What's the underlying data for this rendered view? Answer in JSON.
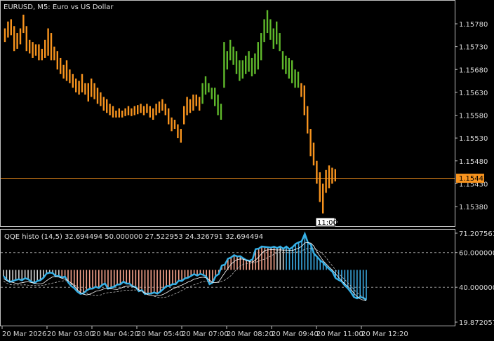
{
  "main_chart": {
    "title": "EURUSD, M5:  Euro vs US Dollar",
    "price_ticks": [
      "1.15780",
      "1.15730",
      "1.15680",
      "1.15630",
      "1.15580",
      "1.15530",
      "1.15480",
      "1.15430",
      "1.15380"
    ],
    "current_price": "1.15442",
    "current_price_value": 1.15442,
    "time_marker": "11:00",
    "colors": {
      "bar_orange": "#f7931e",
      "bar_green": "#5fb82b",
      "current_line": "#f7931e",
      "frame": "#c0c0c0"
    }
  },
  "chart_data": {
    "type": "bar",
    "title": "EURUSD, M5:  Euro vs US Dollar",
    "ylim": [
      1.15355,
      1.1581
    ],
    "bars": [
      {
        "lo": 1.1574,
        "hi": 1.1577,
        "c": "o"
      },
      {
        "lo": 1.1575,
        "hi": 1.15785,
        "c": "o"
      },
      {
        "lo": 1.15755,
        "hi": 1.1579,
        "c": "o"
      },
      {
        "lo": 1.1572,
        "hi": 1.15775,
        "c": "o"
      },
      {
        "lo": 1.15725,
        "hi": 1.1576,
        "c": "o"
      },
      {
        "lo": 1.15735,
        "hi": 1.1577,
        "c": "o"
      },
      {
        "lo": 1.1576,
        "hi": 1.158,
        "c": "o"
      },
      {
        "lo": 1.1572,
        "hi": 1.15775,
        "c": "o"
      },
      {
        "lo": 1.15715,
        "hi": 1.15745,
        "c": "o"
      },
      {
        "lo": 1.15705,
        "hi": 1.1574,
        "c": "o"
      },
      {
        "lo": 1.1571,
        "hi": 1.15735,
        "c": "o"
      },
      {
        "lo": 1.157,
        "hi": 1.15735,
        "c": "o"
      },
      {
        "lo": 1.157,
        "hi": 1.15725,
        "c": "o"
      },
      {
        "lo": 1.15705,
        "hi": 1.15745,
        "c": "o"
      },
      {
        "lo": 1.1571,
        "hi": 1.1577,
        "c": "o"
      },
      {
        "lo": 1.157,
        "hi": 1.1576,
        "c": "o"
      },
      {
        "lo": 1.157,
        "hi": 1.1573,
        "c": "o"
      },
      {
        "lo": 1.1568,
        "hi": 1.1572,
        "c": "o"
      },
      {
        "lo": 1.1567,
        "hi": 1.15705,
        "c": "o"
      },
      {
        "lo": 1.1566,
        "hi": 1.1569,
        "c": "o"
      },
      {
        "lo": 1.15655,
        "hi": 1.157,
        "c": "o"
      },
      {
        "lo": 1.1565,
        "hi": 1.1568,
        "c": "o"
      },
      {
        "lo": 1.1564,
        "hi": 1.1567,
        "c": "o"
      },
      {
        "lo": 1.1563,
        "hi": 1.1566,
        "c": "o"
      },
      {
        "lo": 1.15625,
        "hi": 1.15655,
        "c": "o"
      },
      {
        "lo": 1.1563,
        "hi": 1.1567,
        "c": "o"
      },
      {
        "lo": 1.15625,
        "hi": 1.1565,
        "c": "o"
      },
      {
        "lo": 1.1561,
        "hi": 1.1565,
        "c": "o"
      },
      {
        "lo": 1.1562,
        "hi": 1.1566,
        "c": "o"
      },
      {
        "lo": 1.15615,
        "hi": 1.1565,
        "c": "o"
      },
      {
        "lo": 1.15605,
        "hi": 1.1564,
        "c": "o"
      },
      {
        "lo": 1.156,
        "hi": 1.1563,
        "c": "o"
      },
      {
        "lo": 1.1559,
        "hi": 1.1562,
        "c": "o"
      },
      {
        "lo": 1.15585,
        "hi": 1.15615,
        "c": "o"
      },
      {
        "lo": 1.1558,
        "hi": 1.15605,
        "c": "o"
      },
      {
        "lo": 1.15575,
        "hi": 1.156,
        "c": "o"
      },
      {
        "lo": 1.15575,
        "hi": 1.1559,
        "c": "o"
      },
      {
        "lo": 1.15575,
        "hi": 1.15595,
        "c": "o"
      },
      {
        "lo": 1.15575,
        "hi": 1.1559,
        "c": "o"
      },
      {
        "lo": 1.15578,
        "hi": 1.15595,
        "c": "o"
      },
      {
        "lo": 1.1558,
        "hi": 1.156,
        "c": "o"
      },
      {
        "lo": 1.15578,
        "hi": 1.15595,
        "c": "o"
      },
      {
        "lo": 1.1558,
        "hi": 1.156,
        "c": "o"
      },
      {
        "lo": 1.15582,
        "hi": 1.15602,
        "c": "o"
      },
      {
        "lo": 1.15585,
        "hi": 1.15605,
        "c": "o"
      },
      {
        "lo": 1.1558,
        "hi": 1.156,
        "c": "o"
      },
      {
        "lo": 1.15585,
        "hi": 1.15605,
        "c": "o"
      },
      {
        "lo": 1.15575,
        "hi": 1.156,
        "c": "o"
      },
      {
        "lo": 1.1557,
        "hi": 1.15595,
        "c": "o"
      },
      {
        "lo": 1.1558,
        "hi": 1.15605,
        "c": "o"
      },
      {
        "lo": 1.15585,
        "hi": 1.1561,
        "c": "o"
      },
      {
        "lo": 1.1559,
        "hi": 1.15615,
        "c": "o"
      },
      {
        "lo": 1.1558,
        "hi": 1.15605,
        "c": "o"
      },
      {
        "lo": 1.1556,
        "hi": 1.15595,
        "c": "o"
      },
      {
        "lo": 1.15545,
        "hi": 1.15575,
        "c": "o"
      },
      {
        "lo": 1.1555,
        "hi": 1.1557,
        "c": "o"
      },
      {
        "lo": 1.1553,
        "hi": 1.1556,
        "c": "o"
      },
      {
        "lo": 1.1552,
        "hi": 1.1555,
        "c": "o"
      },
      {
        "lo": 1.1556,
        "hi": 1.156,
        "c": "o"
      },
      {
        "lo": 1.1558,
        "hi": 1.1562,
        "c": "o"
      },
      {
        "lo": 1.15585,
        "hi": 1.15615,
        "c": "o"
      },
      {
        "lo": 1.1559,
        "hi": 1.15625,
        "c": "o"
      },
      {
        "lo": 1.156,
        "hi": 1.15625,
        "c": "o"
      },
      {
        "lo": 1.1559,
        "hi": 1.1562,
        "c": "o"
      },
      {
        "lo": 1.15605,
        "hi": 1.1565,
        "c": "g"
      },
      {
        "lo": 1.15625,
        "hi": 1.15665,
        "c": "g"
      },
      {
        "lo": 1.1563,
        "hi": 1.1565,
        "c": "g"
      },
      {
        "lo": 1.15615,
        "hi": 1.1564,
        "c": "g"
      },
      {
        "lo": 1.156,
        "hi": 1.1564,
        "c": "g"
      },
      {
        "lo": 1.1558,
        "hi": 1.15625,
        "c": "g"
      },
      {
        "lo": 1.1557,
        "hi": 1.15605,
        "c": "g"
      },
      {
        "lo": 1.1564,
        "hi": 1.1574,
        "c": "g"
      },
      {
        "lo": 1.1568,
        "hi": 1.1572,
        "c": "g"
      },
      {
        "lo": 1.157,
        "hi": 1.15745,
        "c": "g"
      },
      {
        "lo": 1.1569,
        "hi": 1.1573,
        "c": "g"
      },
      {
        "lo": 1.1567,
        "hi": 1.1572,
        "c": "g"
      },
      {
        "lo": 1.15655,
        "hi": 1.157,
        "c": "g"
      },
      {
        "lo": 1.1566,
        "hi": 1.157,
        "c": "g"
      },
      {
        "lo": 1.1567,
        "hi": 1.1571,
        "c": "g"
      },
      {
        "lo": 1.15675,
        "hi": 1.1572,
        "c": "g"
      },
      {
        "lo": 1.15665,
        "hi": 1.15705,
        "c": "g"
      },
      {
        "lo": 1.1567,
        "hi": 1.15715,
        "c": "g"
      },
      {
        "lo": 1.1568,
        "hi": 1.1574,
        "c": "g"
      },
      {
        "lo": 1.157,
        "hi": 1.1576,
        "c": "g"
      },
      {
        "lo": 1.1574,
        "hi": 1.1579,
        "c": "g"
      },
      {
        "lo": 1.1576,
        "hi": 1.1581,
        "c": "g"
      },
      {
        "lo": 1.15745,
        "hi": 1.1579,
        "c": "g"
      },
      {
        "lo": 1.15725,
        "hi": 1.1577,
        "c": "g"
      },
      {
        "lo": 1.15735,
        "hi": 1.15785,
        "c": "g"
      },
      {
        "lo": 1.1572,
        "hi": 1.1576,
        "c": "g"
      },
      {
        "lo": 1.1568,
        "hi": 1.1572,
        "c": "g"
      },
      {
        "lo": 1.1567,
        "hi": 1.1571,
        "c": "g"
      },
      {
        "lo": 1.1566,
        "hi": 1.15705,
        "c": "g"
      },
      {
        "lo": 1.1565,
        "hi": 1.157,
        "c": "g"
      },
      {
        "lo": 1.1564,
        "hi": 1.1568,
        "c": "g"
      },
      {
        "lo": 1.1564,
        "hi": 1.15675,
        "c": "g"
      },
      {
        "lo": 1.1562,
        "hi": 1.1565,
        "c": "o"
      },
      {
        "lo": 1.1558,
        "hi": 1.15645,
        "c": "o"
      },
      {
        "lo": 1.1554,
        "hi": 1.156,
        "c": "o"
      },
      {
        "lo": 1.1549,
        "hi": 1.1555,
        "c": "o"
      },
      {
        "lo": 1.1547,
        "hi": 1.1552,
        "c": "o"
      },
      {
        "lo": 1.1543,
        "hi": 1.1548,
        "c": "o"
      },
      {
        "lo": 1.1539,
        "hi": 1.15455,
        "c": "o"
      },
      {
        "lo": 1.15365,
        "hi": 1.1543,
        "c": "o"
      },
      {
        "lo": 1.1541,
        "hi": 1.1546,
        "c": "o"
      },
      {
        "lo": 1.1542,
        "hi": 1.1547,
        "c": "o"
      },
      {
        "lo": 1.1543,
        "hi": 1.15465,
        "c": "o"
      },
      {
        "lo": 1.15435,
        "hi": 1.15462,
        "c": "o"
      }
    ]
  },
  "indicator": {
    "label": "QQE histo (14,5) 32.694494 50.000000 27.522953 24.326791 32.694494",
    "ticks": [
      "71.207561",
      "60.000000",
      "40.000000",
      "19.872057"
    ],
    "tick_values": [
      71.207561,
      60.0,
      40.0,
      19.872057
    ],
    "levels": [
      60,
      40
    ],
    "zero_level": 50,
    "colors": {
      "hist_down": "#f5a38c",
      "hist_up": "#3aa8e0",
      "hist_neutral": "#d0d0d0",
      "rsi_line": "#36b0e6",
      "level_line": "#9a9a9a"
    },
    "rsi": [
      46.5,
      44.3,
      43.1,
      43.5,
      44.2,
      44.6,
      44.0,
      45.2,
      44.6,
      43.3,
      42.4,
      43.6,
      44.1,
      45.5,
      47.9,
      48.4,
      48.2,
      46.3,
      46.6,
      45.6,
      46.2,
      42.9,
      40.7,
      39.5,
      37.5,
      36.2,
      36.5,
      38.1,
      39.1,
      39.2,
      40.3,
      39.5,
      41.2,
      42.2,
      39.2,
      39.8,
      40.3,
      41.5,
      41.7,
      43.2,
      42.1,
      42.1,
      40.5,
      40.1,
      37.7,
      38.3,
      36.1,
      36.4,
      36.3,
      37.0,
      36.3,
      37.4,
      39.0,
      40.7,
      40.7,
      41.8,
      41.8,
      43.8,
      43.6,
      45.1,
      45.5,
      46.5,
      47.6,
      46.7,
      47.7,
      47.1,
      45.9,
      41.8,
      42.6,
      46.4,
      47.6,
      52.5,
      53.1,
      56.4,
      57.2,
      58.5,
      57.8,
      57.9,
      56.7,
      55.6,
      55.3,
      56.1,
      62.0,
      62.3,
      63.5,
      63.3,
      63.1,
      62.9,
      63.4,
      62.6,
      63.5,
      62.2,
      63.5,
      62.0,
      63.1,
      65.0,
      65.9,
      66.6,
      70.8,
      65.8,
      64.5,
      59.4,
      57.6,
      55.5,
      54.1,
      52.1,
      50.4,
      48.9,
      45.3,
      44.2,
      43.3,
      41.0,
      39.4,
      37.1,
      34.3,
      33.6,
      34.4,
      33.9,
      32.7
    ],
    "hist_colors": "gggggggggggggggggggrrrrrrrrrrrrrrrrrrrrrrrrrrrrrrrrrrrrrrrrrrrrrrrrrrrrrrrrrrrrrrrrrrrrrrgggbbbbbbbbbbbbbbbbbbbbbbbbbbbbrrrrrrrrrrrrrrrrrrrrrr"
  },
  "time_axis": [
    "20 Mar 2026",
    "20 Mar 03:00",
    "20 Mar 04:20",
    "20 Mar 05:40",
    "20 Mar 07:00",
    "20 Mar 08:20",
    "20 Mar 09:40",
    "20 Mar 11:00",
    "20 Mar 12:20"
  ]
}
